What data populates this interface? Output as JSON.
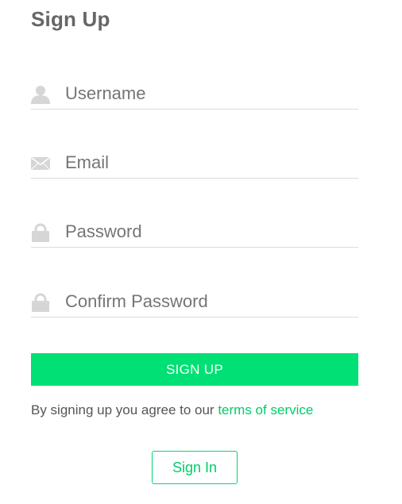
{
  "form": {
    "title": "Sign Up",
    "fields": [
      {
        "name": "username",
        "icon": "user-icon",
        "placeholder": "Username",
        "value": ""
      },
      {
        "name": "email",
        "icon": "envelope-icon",
        "placeholder": "Email",
        "value": ""
      },
      {
        "name": "password",
        "icon": "lock-icon",
        "placeholder": "Password",
        "value": ""
      },
      {
        "name": "confirm_password",
        "icon": "lock-icon",
        "placeholder": "Confirm Password",
        "value": ""
      }
    ],
    "signup_label": "SIGN UP",
    "agree_text": "By signing up you agree to our ",
    "terms_link": "terms of service",
    "signin_label": "Sign In"
  },
  "colors": {
    "accent": "#00e074",
    "link": "#00cc6a",
    "title": "#666666",
    "icon": "#d6d6d6",
    "divider": "#dcdcdc"
  }
}
